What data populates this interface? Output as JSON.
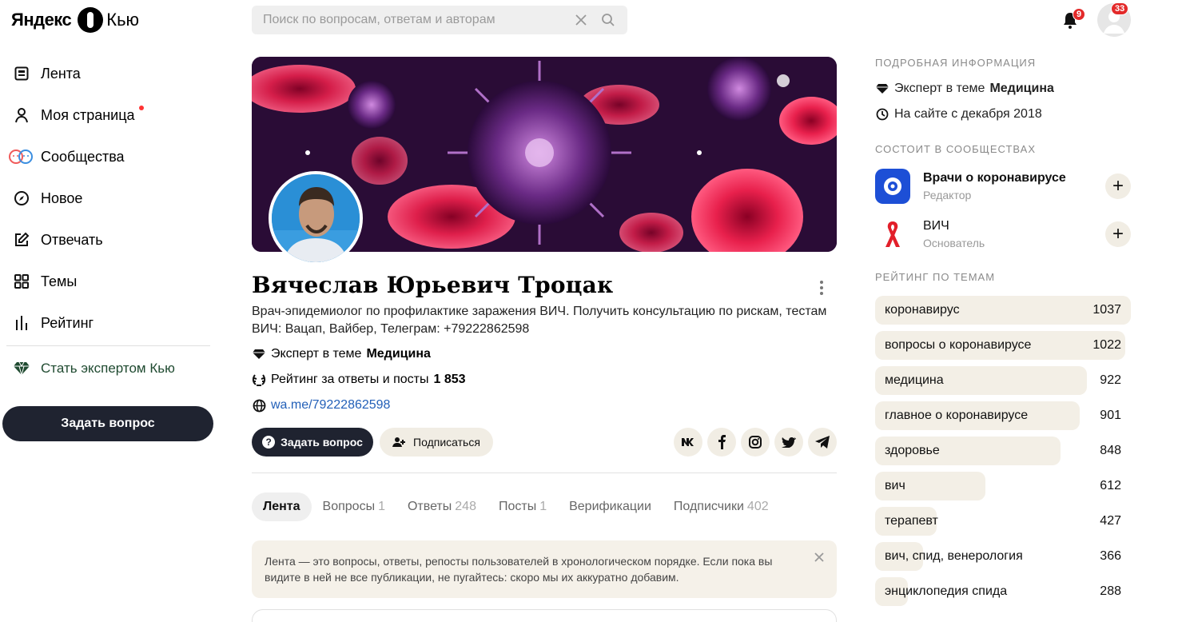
{
  "logo": {
    "brand": "Яндекс",
    "product": "Кью"
  },
  "nav": {
    "items": [
      {
        "label": "Лента"
      },
      {
        "label": "Моя страница"
      },
      {
        "label": "Сообщества"
      },
      {
        "label": "Новое"
      },
      {
        "label": "Отвечать"
      },
      {
        "label": "Темы"
      },
      {
        "label": "Рейтинг"
      }
    ],
    "expert_label": "Стать экспертом Кью",
    "ask_button": "Задать вопрос"
  },
  "search": {
    "placeholder": "Поиск по вопросам, ответам и авторам"
  },
  "header": {
    "notifications_count": "9",
    "profile_count": "33"
  },
  "profile": {
    "name": "Вячеслав Юрьевич Троцак",
    "bio": "Врач-эпидемиолог по профилактике заражения ВИЧ. Получить консультацию по рискам, тестам ВИЧ: Вацап, Вайбер, Телеграм: +79222862598",
    "expert_prefix": "Эксперт в теме",
    "expert_topic": "Медицина",
    "rating_label": "Рейтинг за ответы и посты",
    "rating_value": "1 853",
    "link": "wa.me/79222862598",
    "ask_button": "Задать вопрос",
    "subscribe_button": "Подписаться",
    "socials": [
      "vk-icon",
      "facebook-icon",
      "instagram-icon",
      "twitter-icon",
      "telegram-icon"
    ]
  },
  "tabs": [
    {
      "label": "Лента",
      "count": ""
    },
    {
      "label": "Вопросы",
      "count": "1"
    },
    {
      "label": "Ответы",
      "count": "248"
    },
    {
      "label": "Посты",
      "count": "1"
    },
    {
      "label": "Верификации",
      "count": ""
    },
    {
      "label": "Подписчики",
      "count": "402"
    }
  ],
  "notice": "Лента — это вопросы, ответы, репосты пользователей в хронологическом порядке. Если пока вы видите в ней не все публикации, не пугайтесь: скоро мы их аккуратно добавим.",
  "sidebar": {
    "details_heading": "ПОДРОБНАЯ ИНФОРМАЦИЯ",
    "expert_prefix": "Эксперт в теме",
    "expert_topic": "Медицина",
    "since": "На сайте с декабря 2018",
    "communities_heading": "СОСТОИТ В СООБЩЕСТВАХ",
    "communities": [
      {
        "name": "Врачи о коронавирусе",
        "role": "Редактор"
      },
      {
        "name": "ВИЧ",
        "role": "Основатель"
      }
    ],
    "rating_heading": "РЕЙТИНГ ПО ТЕМАМ",
    "ratings": [
      {
        "topic": "коронавирус",
        "value": 1037
      },
      {
        "topic": "вопросы о коронавирусе",
        "value": 1022
      },
      {
        "topic": "медицина",
        "value": 922
      },
      {
        "topic": "главное о коронавирусе",
        "value": 901
      },
      {
        "topic": "здоровье",
        "value": 848
      },
      {
        "topic": "вич",
        "value": 612
      },
      {
        "topic": "терапевт",
        "value": 427
      },
      {
        "topic": "вич, спид, венерология",
        "value": 366
      },
      {
        "topic": "энциклопедия спида",
        "value": 288
      }
    ]
  },
  "colors": {
    "accent_dark": "#1f2330",
    "beige": "#f3efe6",
    "link": "#2360b8",
    "badge": "#e32a2a",
    "expert_green": "#1f4a30"
  }
}
